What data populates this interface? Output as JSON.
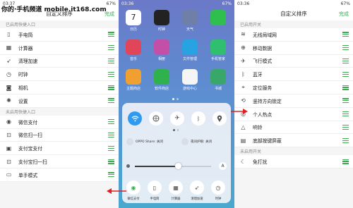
{
  "watermark": "你的·手机频道 mobile.it168.com",
  "left": {
    "status_time": "03:37",
    "status_battery": "67%",
    "title": "自定义排序",
    "done": "完成",
    "section_enabled": "已启用快捷入口",
    "enabled": [
      {
        "label": "手电筒",
        "icon": "flashlight-icon"
      },
      {
        "label": "计算器",
        "icon": "calculator-icon"
      },
      {
        "label": "清理加速",
        "icon": "rocket-icon"
      },
      {
        "label": "时钟",
        "icon": "clock-icon"
      },
      {
        "label": "相机",
        "icon": "camera-icon"
      },
      {
        "label": "设置",
        "icon": "gear-icon"
      }
    ],
    "section_disabled": "未启用快捷入口",
    "disabled": [
      {
        "label": "微信支付",
        "icon": "wechat-pay-icon"
      },
      {
        "label": "微信扫一扫",
        "icon": "scan-icon"
      },
      {
        "label": "支付宝支付",
        "icon": "alipay-icon"
      },
      {
        "label": "支付宝扫一扫",
        "icon": "scan-icon"
      },
      {
        "label": "单手模式",
        "icon": "one-hand-icon"
      }
    ]
  },
  "mid": {
    "status_time": "03:36",
    "status_battery": "67%",
    "apps": [
      {
        "label": "日历",
        "color": "#ffffff",
        "glyph": "7"
      },
      {
        "label": "时钟",
        "color": "#222222",
        "glyph": ""
      },
      {
        "label": "天气",
        "color": "#6f7fa8",
        "glyph": ""
      },
      {
        "label": "",
        "color": "#2fbf4f",
        "glyph": ""
      },
      {
        "label": "音乐",
        "color": "#e0455a",
        "glyph": ""
      },
      {
        "label": "相册",
        "color": "#c44fa8",
        "glyph": ""
      },
      {
        "label": "文件管理",
        "color": "#26a3e0",
        "glyph": ""
      },
      {
        "label": "手机管家",
        "color": "#2fbf6f",
        "glyph": ""
      },
      {
        "label": "主题商店",
        "color": "#f0a030",
        "glyph": ""
      },
      {
        "label": "软件商店",
        "color": "#2fb14e",
        "glyph": ""
      },
      {
        "label": "游戏中心",
        "color": "#f5f5f5",
        "glyph": ""
      },
      {
        "label": "书城",
        "color": "#3aa76a",
        "glyph": ""
      }
    ],
    "oppo_share": "OPPO Share: 关闭",
    "night_mode": "夜间护眼: 关闭",
    "brightness_auto": "A",
    "tools": [
      "微信支付",
      "手电筒",
      "计算器",
      "清理加速",
      "时钟"
    ]
  },
  "right": {
    "status_time": "03:36",
    "status_battery": "67%",
    "title": "自定义排序",
    "done": "完成",
    "section_enabled": "已启用开关",
    "enabled": [
      {
        "label": "无线局域网",
        "icon": "wifi-icon"
      },
      {
        "label": "移动数据",
        "icon": "globe-icon"
      },
      {
        "label": "飞行模式",
        "icon": "airplane-icon"
      },
      {
        "label": "蓝牙",
        "icon": "bluetooth-icon"
      },
      {
        "label": "定位服务",
        "icon": "location-icon"
      },
      {
        "label": "竖持方向锁定",
        "icon": "rotation-lock-icon"
      },
      {
        "label": "个人热点",
        "icon": "hotspot-icon"
      },
      {
        "label": "响铃",
        "icon": "bell-icon"
      },
      {
        "label": "底部按键屏蔽",
        "icon": "keys-lock-icon"
      }
    ],
    "section_disabled": "未启用开关",
    "disabled": [
      {
        "label": "免打扰",
        "icon": "moon-icon"
      }
    ]
  }
}
